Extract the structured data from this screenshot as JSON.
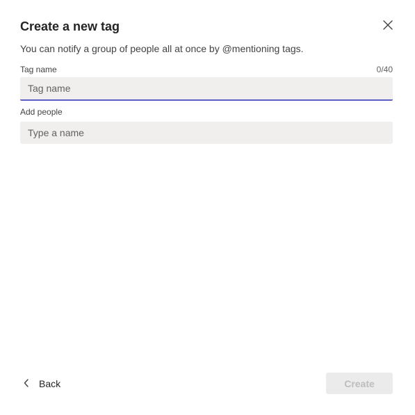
{
  "dialog": {
    "title": "Create a new tag",
    "subtitle": "You can notify a group of people all at once by @mentioning tags."
  },
  "tag_name": {
    "label": "Tag name",
    "counter": "0/40",
    "value": "",
    "placeholder": "Tag name"
  },
  "add_people": {
    "label": "Add people",
    "value": "",
    "placeholder": "Type a name"
  },
  "footer": {
    "back_label": "Back",
    "create_label": "Create"
  },
  "icons": {
    "close": "close-icon",
    "back": "chevron-left-icon"
  },
  "colors": {
    "accent": "#5b5fc7",
    "input_bg": "#f0efee",
    "disabled_bg": "#ebebeb",
    "disabled_text": "#bdbdbd"
  }
}
